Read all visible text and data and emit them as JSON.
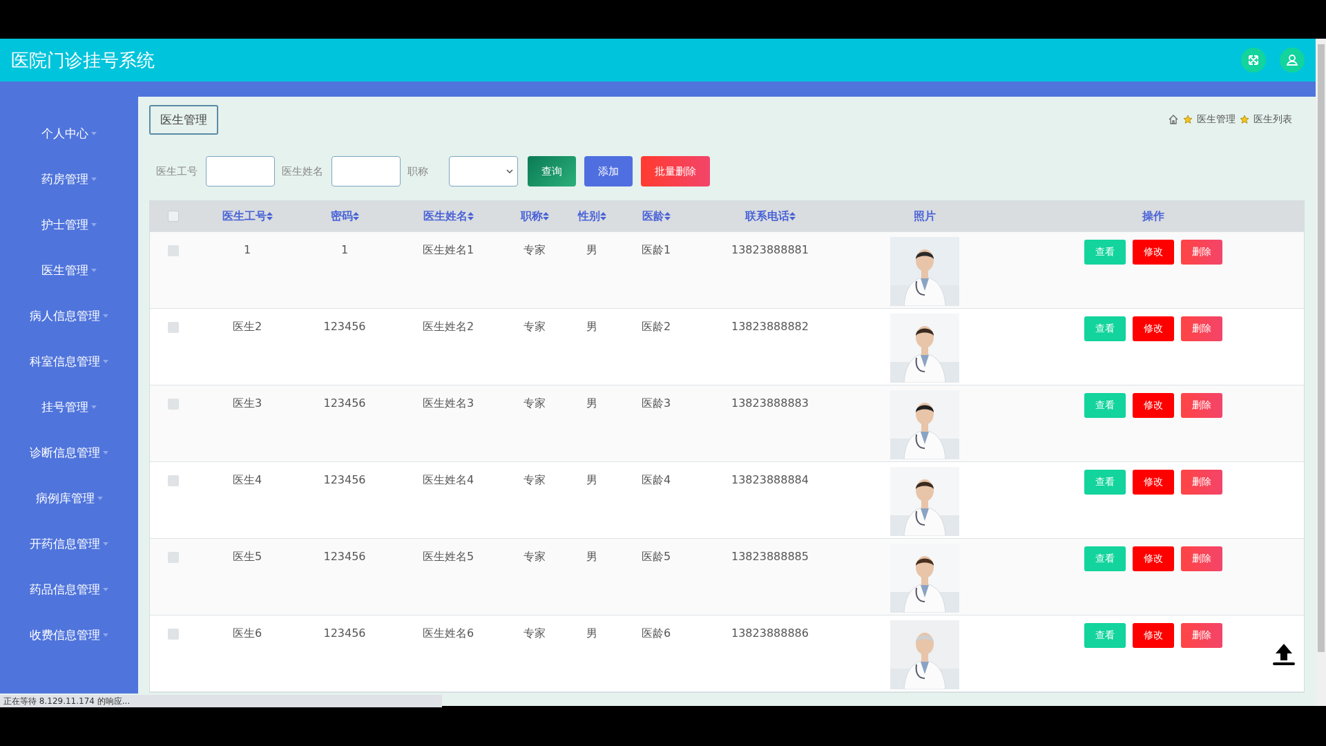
{
  "header": {
    "title": "医院门诊挂号系统"
  },
  "sidebar": {
    "items": [
      {
        "label": "个人中心"
      },
      {
        "label": "药房管理"
      },
      {
        "label": "护士管理"
      },
      {
        "label": "医生管理"
      },
      {
        "label": "病人信息管理"
      },
      {
        "label": "科室信息管理"
      },
      {
        "label": "挂号管理"
      },
      {
        "label": "诊断信息管理"
      },
      {
        "label": "病例库管理"
      },
      {
        "label": "开药信息管理"
      },
      {
        "label": "药品信息管理"
      },
      {
        "label": "收费信息管理"
      }
    ]
  },
  "page_title": "医生管理",
  "breadcrumb": [
    "医生管理",
    "医生列表"
  ],
  "search": {
    "fields": [
      {
        "label": "医生工号",
        "kind": "text"
      },
      {
        "label": "医生姓名",
        "kind": "text"
      },
      {
        "label": "职称",
        "kind": "select"
      }
    ],
    "buttons": [
      {
        "label": "查询",
        "kind": "query"
      },
      {
        "label": "添加",
        "kind": "add"
      },
      {
        "label": "批量删除",
        "kind": "bulk-delete"
      }
    ]
  },
  "table": {
    "select_all": {
      "checked": false
    },
    "columns": [
      {
        "label": "医生工号",
        "sortable": true
      },
      {
        "label": "密码",
        "sortable": true
      },
      {
        "label": "医生姓名",
        "sortable": true
      },
      {
        "label": "职称",
        "sortable": true
      },
      {
        "label": "性别",
        "sortable": true
      },
      {
        "label": "医龄",
        "sortable": true
      },
      {
        "label": "联系电话",
        "sortable": true
      },
      {
        "label": "照片",
        "sortable": false
      },
      {
        "label": "操作",
        "sortable": false
      }
    ],
    "rows": [
      {
        "checked": false,
        "cells": [
          "1",
          "1",
          "医生姓名1",
          "专家",
          "男",
          "医龄1",
          "13823888881"
        ],
        "actions": [
          {
            "label": "查看",
            "kind": "view"
          },
          {
            "label": "修改",
            "kind": "edit"
          },
          {
            "label": "删除",
            "kind": "delete"
          }
        ]
      },
      {
        "checked": false,
        "cells": [
          "医生2",
          "123456",
          "医生姓名2",
          "专家",
          "男",
          "医龄2",
          "13823888882"
        ],
        "actions": [
          {
            "label": "查看",
            "kind": "view"
          },
          {
            "label": "修改",
            "kind": "edit"
          },
          {
            "label": "删除",
            "kind": "delete"
          }
        ]
      },
      {
        "checked": false,
        "cells": [
          "医生3",
          "123456",
          "医生姓名3",
          "专家",
          "男",
          "医龄3",
          "13823888883"
        ],
        "actions": [
          {
            "label": "查看",
            "kind": "view"
          },
          {
            "label": "修改",
            "kind": "edit"
          },
          {
            "label": "删除",
            "kind": "delete"
          }
        ]
      },
      {
        "checked": false,
        "cells": [
          "医生4",
          "123456",
          "医生姓名4",
          "专家",
          "男",
          "医龄4",
          "13823888884"
        ],
        "actions": [
          {
            "label": "查看",
            "kind": "view"
          },
          {
            "label": "修改",
            "kind": "edit"
          },
          {
            "label": "删除",
            "kind": "delete"
          }
        ]
      },
      {
        "checked": false,
        "cells": [
          "医生5",
          "123456",
          "医生姓名5",
          "专家",
          "男",
          "医龄5",
          "13823888885"
        ],
        "actions": [
          {
            "label": "查看",
            "kind": "view"
          },
          {
            "label": "修改",
            "kind": "edit"
          },
          {
            "label": "删除",
            "kind": "delete"
          }
        ]
      },
      {
        "checked": false,
        "cells": [
          "医生6",
          "123456",
          "医生姓名6",
          "专家",
          "男",
          "医龄6",
          "13823888886"
        ],
        "actions": [
          {
            "label": "查看",
            "kind": "view"
          },
          {
            "label": "修改",
            "kind": "edit"
          },
          {
            "label": "删除",
            "kind": "delete"
          }
        ]
      }
    ]
  },
  "status_bar": {
    "text": "正在等待 8.129.11.174 的响应..."
  }
}
